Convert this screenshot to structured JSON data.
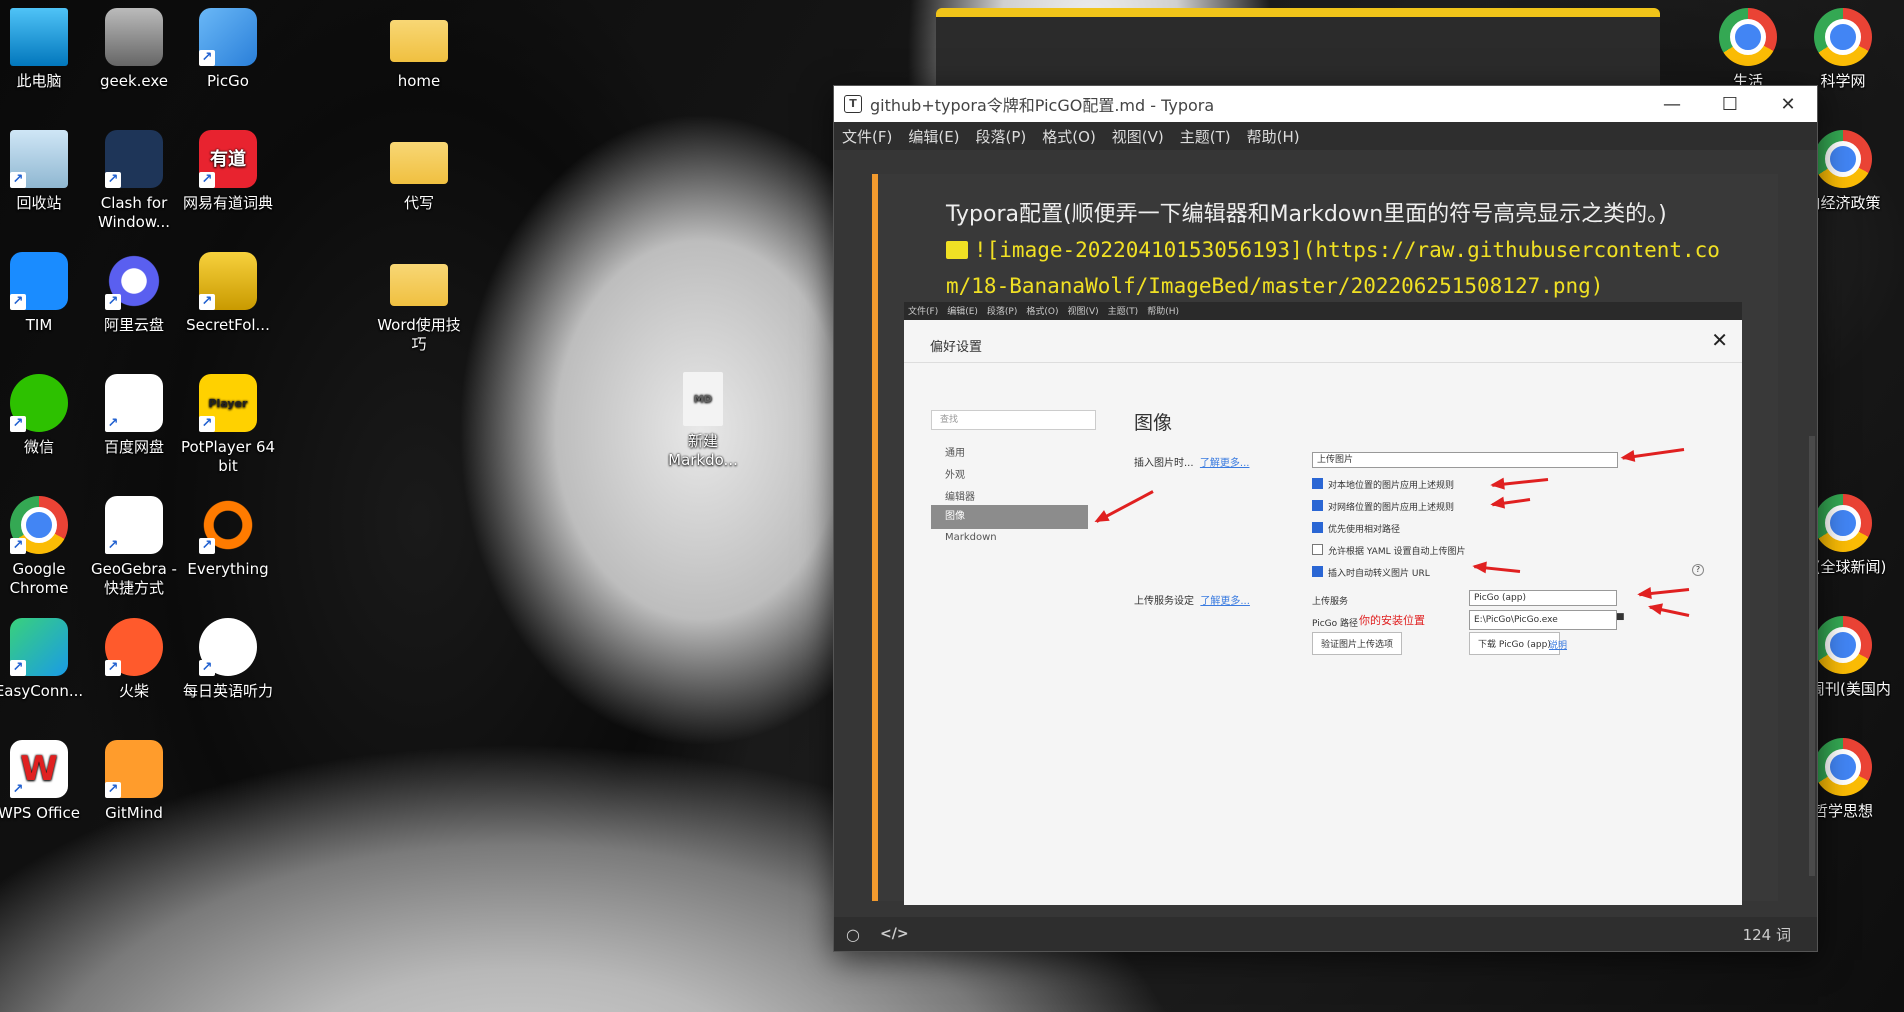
{
  "desktop": {
    "left_icons": [
      {
        "label": "此电脑",
        "icon": "computer-icon"
      },
      {
        "label": "geek.exe",
        "icon": "geek-icon"
      },
      {
        "label": "PicGo",
        "icon": "picgo-icon"
      },
      {
        "label": "回收站",
        "icon": "recycle-bin-icon"
      },
      {
        "label": "Clash for Window...",
        "icon": "clash-icon"
      },
      {
        "label": "网易有道词典",
        "icon": "youdao-icon",
        "glyph": "有道"
      },
      {
        "label": "TIM",
        "icon": "tim-icon"
      },
      {
        "label": "阿里云盘",
        "icon": "aliyun-drive-icon"
      },
      {
        "label": "SecretFol...",
        "icon": "lock-icon"
      },
      {
        "label": "微信",
        "icon": "wechat-icon"
      },
      {
        "label": "百度网盘",
        "icon": "baidu-netdisk-icon"
      },
      {
        "label": "PotPlayer 64 bit",
        "icon": "potplayer-icon",
        "glyph": "Player"
      },
      {
        "label": "Google Chrome",
        "icon": "chrome-icon"
      },
      {
        "label": "GeoGebra - 快捷方式",
        "icon": "geogebra-icon"
      },
      {
        "label": "Everything",
        "icon": "everything-icon"
      },
      {
        "label": "EasyConn...",
        "icon": "easyconnect-icon"
      },
      {
        "label": "火柴",
        "icon": "huochai-icon"
      },
      {
        "label": "每日英语听力",
        "icon": "english-listening-icon"
      },
      {
        "label": "WPS Office",
        "icon": "wps-icon",
        "glyph": "W"
      },
      {
        "label": "GitMind",
        "icon": "gitmind-icon"
      }
    ],
    "folders": [
      {
        "label": "home"
      },
      {
        "label": "代写"
      },
      {
        "label": "Word使用技巧"
      }
    ],
    "file": {
      "label": "新建 Markdo...",
      "icon": "markdown-file-icon"
    },
    "right_icons": [
      {
        "label": "生活"
      },
      {
        "label": "科学网"
      },
      {
        "label": "内经济政策"
      },
      {
        "label": "代(全球新闻)"
      },
      {
        "label": "闻周刊(美国内新闻)"
      },
      {
        "label": "哲学思想"
      }
    ]
  },
  "typora": {
    "title": "github+typora令牌和PicGO配置.md - Typora",
    "app_letter": "T",
    "menu": [
      "文件(F)",
      "编辑(E)",
      "段落(P)",
      "格式(O)",
      "视图(V)",
      "主题(T)",
      "帮助(H)"
    ],
    "paragraph": "Typora配置(顺便弄一下编辑器和Markdown里面的符号高亮显示之类的。)",
    "code_line1": "![image-20220410153056193](https://raw.githubusercontent.co",
    "code_line2": "m/18-BananaWolf/ImageBed/master/202206251508127.png)",
    "word_count": "124 词",
    "screenshot": {
      "menu": [
        "文件(F)",
        "编辑(E)",
        "段落(P)",
        "格式(O)",
        "视图(V)",
        "主题(T)",
        "帮助(H)"
      ],
      "dialog_title": "偏好设置",
      "search_placeholder": "查找",
      "nav": [
        "通用",
        "外观",
        "编辑器",
        "图像",
        "Markdown"
      ],
      "heading": "图像",
      "insert_label": "插入图片时...",
      "learn_more": "了解更多...",
      "insert_select": "上传图片",
      "checks": [
        {
          "label": "对本地位置的图片应用上述规则",
          "checked": true
        },
        {
          "label": "对网络位置的图片应用上述规则",
          "checked": true
        },
        {
          "label": "优先使用相对路径",
          "checked": true
        },
        {
          "label": "允许根据 YAML 设置自动上传图片",
          "checked": false
        },
        {
          "label": "插入时自动转义图片 URL",
          "checked": true
        }
      ],
      "help_glyph": "?",
      "upload_label": "上传服务设定",
      "upload_learn_more": "了解更多...",
      "service_label": "上传服务",
      "service_value": "PicGo (app)",
      "path_label": "PicGo 路径",
      "path_note": "你的安装位置",
      "path_value": "E:\\PicGo\\PicGo.exe",
      "verify_button": "验证图片上传选项",
      "download_button": "下载 PicGo (app)",
      "explain_link": "说明"
    }
  },
  "colors": {
    "accent_bar": "#f29a2e",
    "code": "#f0e024",
    "annotation_red": "#e02020"
  }
}
